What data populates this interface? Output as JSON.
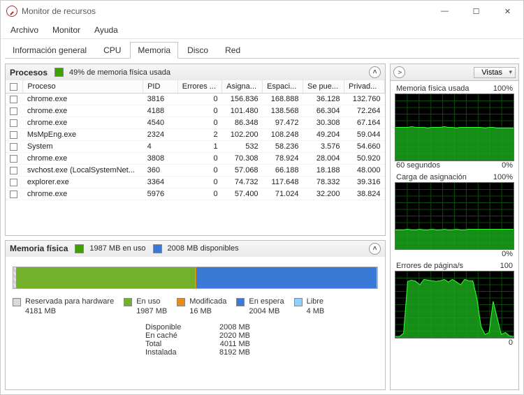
{
  "window": {
    "title": "Monitor de recursos"
  },
  "menus": {
    "file": "Archivo",
    "monitor": "Monitor",
    "help": "Ayuda"
  },
  "tabs": {
    "overview": "Información general",
    "cpu": "CPU",
    "memory": "Memoria",
    "disk": "Disco",
    "network": "Red"
  },
  "procesos": {
    "heading": "Procesos",
    "legend": "49% de memoria física usada",
    "columns": {
      "proc": "Proceso",
      "pid": "PID",
      "err": "Errores ...",
      "asig": "Asigna...",
      "esp": "Espaci...",
      "se": "Se pue...",
      "priv": "Privad..."
    },
    "rows": [
      {
        "name": "chrome.exe",
        "pid": "3816",
        "err": "0",
        "asig": "156.836",
        "esp": "168.888",
        "se": "36.128",
        "priv": "132.760"
      },
      {
        "name": "chrome.exe",
        "pid": "4188",
        "err": "0",
        "asig": "101.480",
        "esp": "138.568",
        "se": "66.304",
        "priv": "72.264"
      },
      {
        "name": "chrome.exe",
        "pid": "4540",
        "err": "0",
        "asig": "86.348",
        "esp": "97.472",
        "se": "30.308",
        "priv": "67.164"
      },
      {
        "name": "MsMpEng.exe",
        "pid": "2324",
        "err": "2",
        "asig": "102.200",
        "esp": "108.248",
        "se": "49.204",
        "priv": "59.044"
      },
      {
        "name": "System",
        "pid": "4",
        "err": "1",
        "asig": "532",
        "esp": "58.236",
        "se": "3.576",
        "priv": "54.660"
      },
      {
        "name": "chrome.exe",
        "pid": "3808",
        "err": "0",
        "asig": "70.308",
        "esp": "78.924",
        "se": "28.004",
        "priv": "50.920"
      },
      {
        "name": "svchost.exe (LocalSystemNet...",
        "pid": "360",
        "err": "0",
        "asig": "57.068",
        "esp": "66.188",
        "se": "18.188",
        "priv": "48.000"
      },
      {
        "name": "explorer.exe",
        "pid": "3364",
        "err": "0",
        "asig": "74.732",
        "esp": "117.648",
        "se": "78.332",
        "priv": "39.316"
      },
      {
        "name": "chrome.exe",
        "pid": "5976",
        "err": "0",
        "asig": "57.400",
        "esp": "71.024",
        "se": "32.200",
        "priv": "38.824"
      }
    ]
  },
  "memfisica": {
    "heading": "Memoria física",
    "in_use_legend": "1987 MB en uso",
    "avail_legend": "2008 MB disponibles",
    "segments": {
      "reserved": {
        "label": "Reservada para hardware",
        "value": "4181 MB"
      },
      "inuse": {
        "label": "En uso",
        "value": "1987 MB"
      },
      "modified": {
        "label": "Modificada",
        "value": "16 MB"
      },
      "standby": {
        "label": "En espera",
        "value": "2004 MB"
      },
      "free": {
        "label": "Libre",
        "value": "4 MB"
      }
    },
    "stats": {
      "available": {
        "k": "Disponible",
        "v": "2008 MB"
      },
      "cached": {
        "k": "En caché",
        "v": "2020 MB"
      },
      "total": {
        "k": "Total",
        "v": "4011 MB"
      },
      "installed": {
        "k": "Instalada",
        "v": "8192 MB"
      }
    }
  },
  "right": {
    "views": "Vistas",
    "chart1": {
      "title": "Memoria física usada",
      "tr": "100%",
      "bl": "60 segundos",
      "br": "0%"
    },
    "chart2": {
      "title": "Carga de asignación",
      "tr": "100%",
      "br": "0%"
    },
    "chart3": {
      "title": "Errores de página/s",
      "tr": "100",
      "br": "0"
    }
  },
  "chart_data": [
    {
      "type": "area",
      "title": "Memoria física usada",
      "ylim": [
        0,
        100
      ],
      "xseconds": 60,
      "values": [
        50,
        50,
        50,
        50,
        51,
        50,
        50,
        50,
        49,
        50,
        50,
        50,
        51,
        50,
        50,
        49,
        50,
        50,
        50,
        50,
        50,
        50,
        49,
        50,
        50,
        49,
        49,
        49,
        49,
        49
      ]
    },
    {
      "type": "area",
      "title": "Carga de asignación",
      "ylim": [
        0,
        100
      ],
      "xseconds": 60,
      "values": [
        29,
        29,
        29,
        30,
        29,
        29,
        30,
        29,
        29,
        30,
        29,
        29,
        30,
        29,
        29,
        30,
        29,
        29,
        30,
        30,
        30,
        30,
        30,
        30,
        30,
        30,
        30,
        30,
        30,
        30
      ]
    },
    {
      "type": "area",
      "title": "Errores de página/s",
      "ylim": [
        0,
        100
      ],
      "xseconds": 60,
      "values": [
        2,
        2,
        7,
        85,
        87,
        85,
        80,
        88,
        87,
        86,
        85,
        86,
        88,
        84,
        88,
        84,
        80,
        88,
        86,
        86,
        60,
        17,
        5,
        8,
        55,
        30,
        5,
        8,
        3,
        2
      ]
    }
  ]
}
